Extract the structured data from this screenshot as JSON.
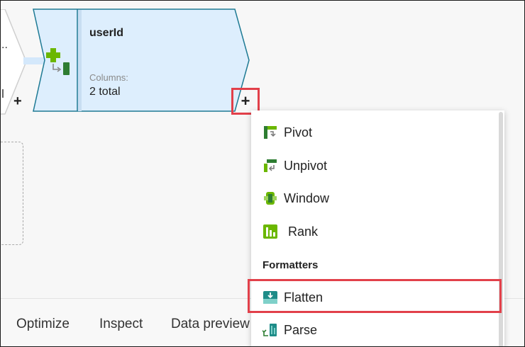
{
  "node": {
    "title": "userId",
    "columns_label": "Columns:",
    "columns_value": "2 total",
    "icon": "select-transform-icon"
  },
  "previous_node": {
    "dots": "..",
    "plus": "+"
  },
  "add_button": {
    "label": "+"
  },
  "menu": {
    "items": [
      {
        "label": "Pivot",
        "icon": "pivot-icon"
      },
      {
        "label": "Unpivot",
        "icon": "unpivot-icon"
      },
      {
        "label": "Window",
        "icon": "window-icon"
      },
      {
        "label": "Rank",
        "icon": "rank-icon"
      }
    ],
    "section_title": "Formatters",
    "formatters": [
      {
        "label": "Flatten",
        "icon": "flatten-icon"
      },
      {
        "label": "Parse",
        "icon": "parse-icon"
      }
    ]
  },
  "tabs": [
    {
      "label": "Optimize"
    },
    {
      "label": "Inspect"
    },
    {
      "label": "Data preview"
    }
  ],
  "colors": {
    "node_fill": "#ddeefd",
    "node_border": "#1e7a94",
    "highlight": "#e2404a",
    "icon_green": "#6bb700",
    "icon_dark_green": "#2e7d32",
    "icon_teal": "#1e8c88"
  }
}
